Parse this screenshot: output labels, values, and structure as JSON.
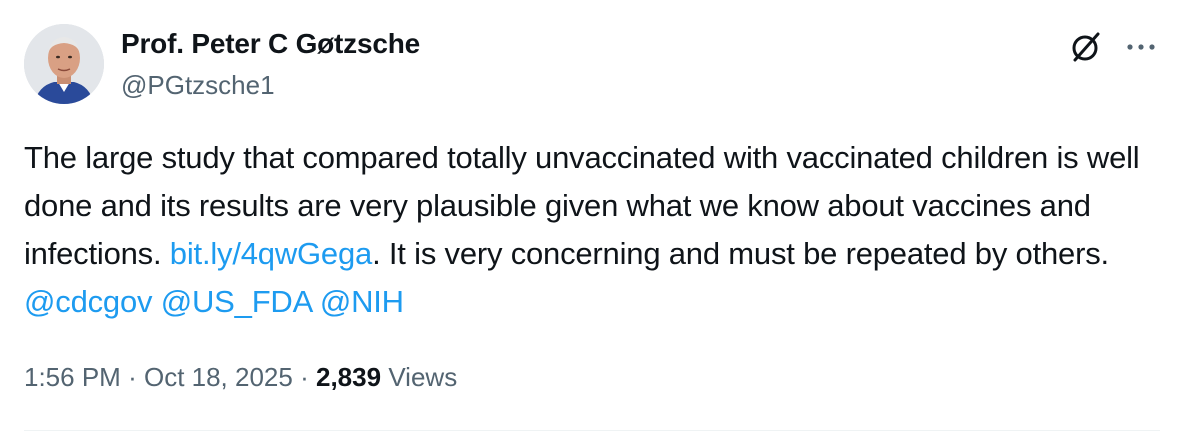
{
  "author": {
    "name": "Prof. Peter C Gøtzsche",
    "handle": "@PGtzsche1"
  },
  "header_icons": {
    "grok": "grok-icon",
    "more": "more-horizontal-icon"
  },
  "tweet": {
    "text_part1": "The large study that compared totally unvaccinated with vaccinated children is well done and its results are very plausible given what we know about vaccines and infections. ",
    "link": "bit.ly/4qwGega",
    "text_part2": ". It is very concerning and must be repeated by others. ",
    "mention_1": "@cdcgov",
    "mention_2": "@US_FDA",
    "mention_3": "@NIH"
  },
  "meta": {
    "time": "1:56 PM",
    "separator": "·",
    "date": "Oct 18, 2025",
    "views_count": "2,839",
    "views_label": "Views"
  },
  "colors": {
    "text": "#0f1419",
    "secondary": "#536471",
    "link": "#1d9bf0"
  }
}
